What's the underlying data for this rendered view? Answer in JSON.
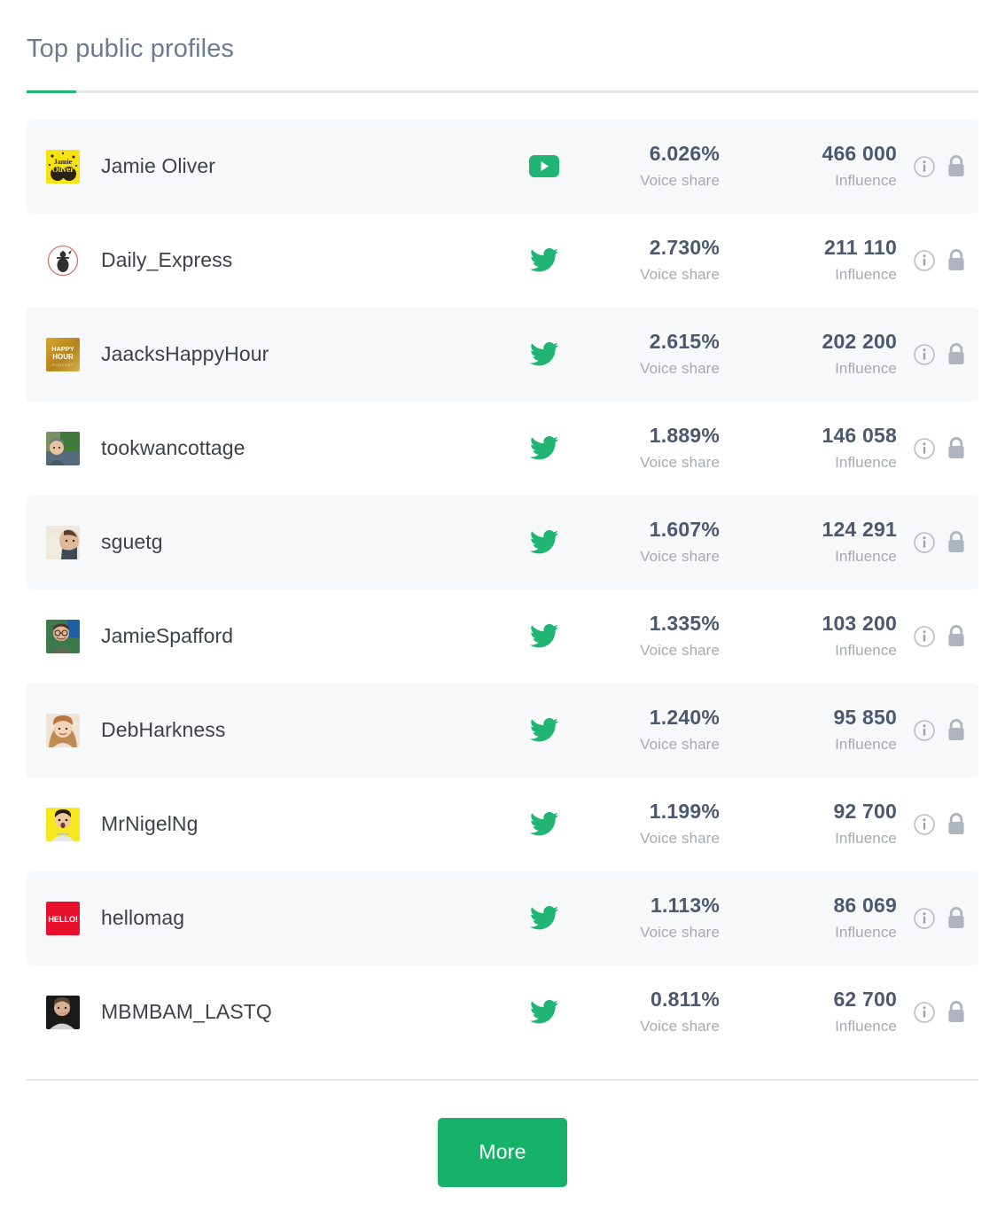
{
  "header": {
    "title": "Top public profiles",
    "accent_color": "#21b573"
  },
  "columns": {
    "voice_share_label": "Voice share",
    "influence_label": "Influence"
  },
  "icons": {
    "info": "info-icon",
    "lock": "lock-icon",
    "youtube": "youtube-icon",
    "twitter": "twitter-icon"
  },
  "rows": [
    {
      "name": "Jamie Oliver",
      "network": "youtube",
      "voice_share": "6.026%",
      "voice_share_label": "Voice share",
      "influence": "466 000",
      "influence_label": "Influence",
      "avatar": "jamie-oliver-avatar"
    },
    {
      "name": "Daily_Express",
      "network": "twitter",
      "voice_share": "2.730%",
      "voice_share_label": "Voice share",
      "influence": "211 110",
      "influence_label": "Influence",
      "avatar": "daily-express-avatar"
    },
    {
      "name": "JaacksHappyHour",
      "network": "twitter",
      "voice_share": "2.615%",
      "voice_share_label": "Voice share",
      "influence": "202 200",
      "influence_label": "Influence",
      "avatar": "jaacks-happy-hour-avatar"
    },
    {
      "name": "tookwancottage",
      "network": "twitter",
      "voice_share": "1.889%",
      "voice_share_label": "Voice share",
      "influence": "146 058",
      "influence_label": "Influence",
      "avatar": "tookwancottage-avatar"
    },
    {
      "name": "sguetg",
      "network": "twitter",
      "voice_share": "1.607%",
      "voice_share_label": "Voice share",
      "influence": "124 291",
      "influence_label": "Influence",
      "avatar": "sguetg-avatar"
    },
    {
      "name": "JamieSpafford",
      "network": "twitter",
      "voice_share": "1.335%",
      "voice_share_label": "Voice share",
      "influence": "103 200",
      "influence_label": "Influence",
      "avatar": "jamie-spafford-avatar"
    },
    {
      "name": "DebHarkness",
      "network": "twitter",
      "voice_share": "1.240%",
      "voice_share_label": "Voice share",
      "influence": "95 850",
      "influence_label": "Influence",
      "avatar": "deb-harkness-avatar"
    },
    {
      "name": "MrNigelNg",
      "network": "twitter",
      "voice_share": "1.199%",
      "voice_share_label": "Voice share",
      "influence": "92 700",
      "influence_label": "Influence",
      "avatar": "mr-nigel-ng-avatar"
    },
    {
      "name": "hellomag",
      "network": "twitter",
      "voice_share": "1.113%",
      "voice_share_label": "Voice share",
      "influence": "86 069",
      "influence_label": "Influence",
      "avatar": "hellomag-avatar"
    },
    {
      "name": "MBMBAM_LASTQ",
      "network": "twitter",
      "voice_share": "0.811%",
      "voice_share_label": "Voice share",
      "influence": "62 700",
      "influence_label": "Influence",
      "avatar": "mbmbam-lastq-avatar"
    }
  ],
  "footer": {
    "more_label": "More",
    "more_color": "#17b26a"
  }
}
